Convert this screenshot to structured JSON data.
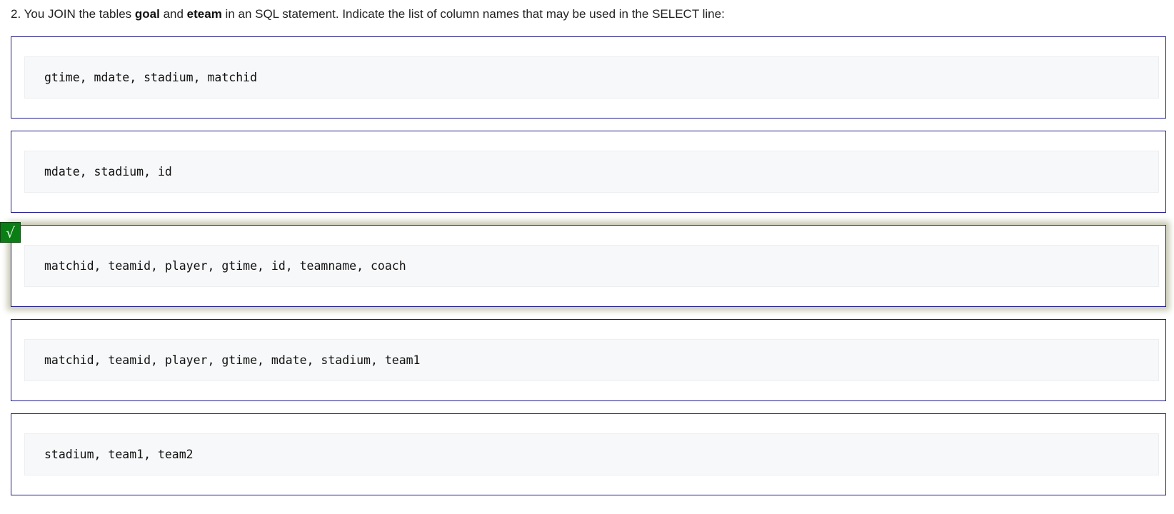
{
  "question": {
    "prefix": "2. You JOIN the tables ",
    "table1": "goal",
    "middle": " and ",
    "table2": "eteam",
    "suffix": " in an SQL statement. Indicate the list of column names that may be used in the SELECT line:"
  },
  "options": [
    {
      "text": "gtime, mdate, stadium, matchid",
      "selected": false
    },
    {
      "text": "mdate, stadium, id",
      "selected": false
    },
    {
      "text": "matchid, teamid, player, gtime, id, teamname, coach",
      "selected": true
    },
    {
      "text": "matchid, teamid, player, gtime, mdate, stadium, team1",
      "selected": false
    },
    {
      "text": "stadium, team1, team2",
      "selected": false
    }
  ],
  "selected_mark": {
    "icon": "check-icon",
    "glyph": "√",
    "color": "#0a7d14"
  }
}
